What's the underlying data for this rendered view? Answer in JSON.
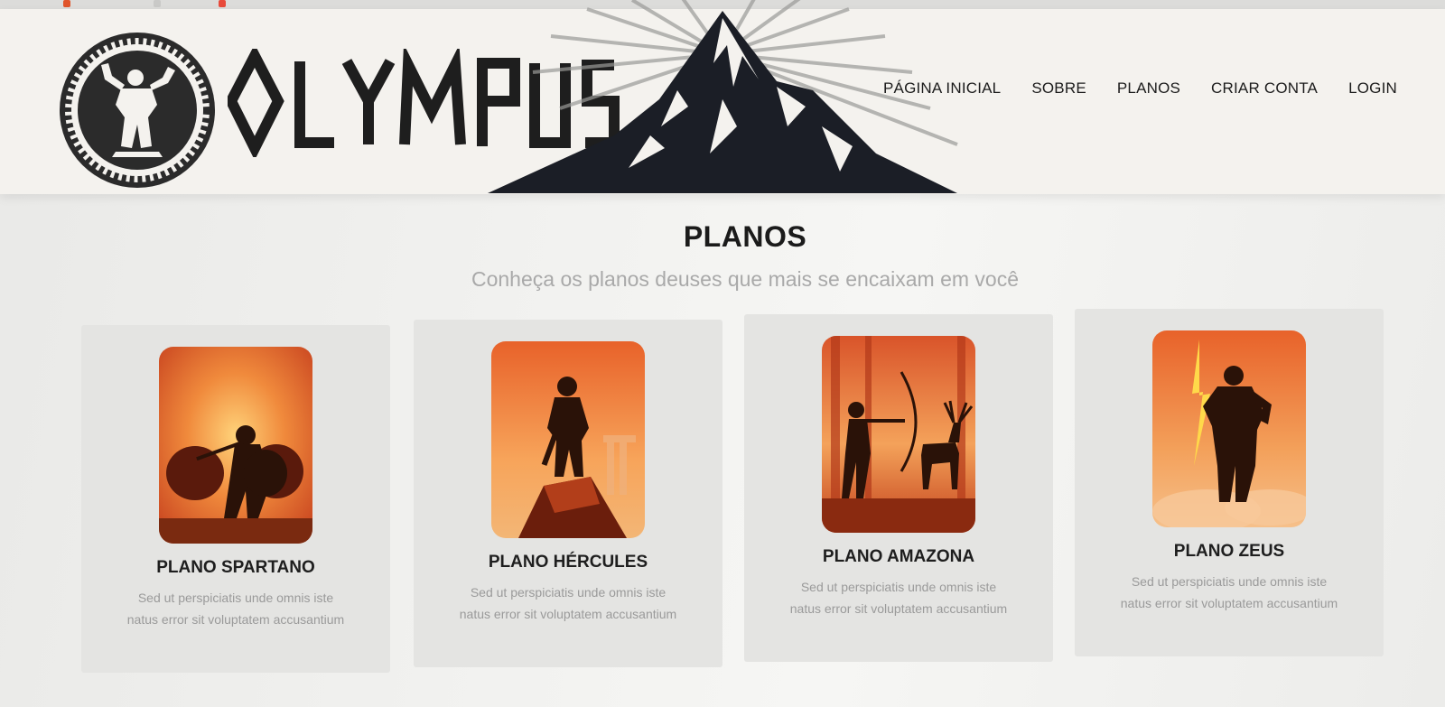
{
  "brand": {
    "name": "OLYMPUS"
  },
  "nav": {
    "items": [
      {
        "label": "PÁGINA INICIAL"
      },
      {
        "label": "SOBRE"
      },
      {
        "label": "PLANOS"
      },
      {
        "label": "CRIAR CONTA"
      },
      {
        "label": "LOGIN"
      }
    ]
  },
  "section": {
    "title": "PLANOS",
    "subtitle": "Conheça os planos deuses que mais se encaixam em você"
  },
  "plans": [
    {
      "title": "PLANO SPARTANO",
      "description": "Sed ut perspiciatis unde omnis iste natus error sit voluptatem accusantium",
      "icon": "spartan-warriors-illustration"
    },
    {
      "title": "PLANO HÉRCULES",
      "description": "Sed ut perspiciatis unde omnis iste natus error sit voluptatem accusantium",
      "icon": "hercules-on-rock-illustration"
    },
    {
      "title": "PLANO AMAZONA",
      "description": "Sed ut perspiciatis unde omnis iste natus error sit voluptatem accusantium",
      "icon": "amazon-archer-with-deer-illustration"
    },
    {
      "title": "PLANO ZEUS",
      "description": "Sed ut perspiciatis unde omnis iste natus error sit voluptatem accusantium",
      "icon": "zeus-with-lightning-illustration"
    }
  ],
  "colors": {
    "card_bg": "#e4e4e2",
    "title": "#1b1b1b",
    "subtitle": "#a9a9a9",
    "illustration_orange": "#e8622a",
    "illustration_dark": "#2a1208"
  }
}
